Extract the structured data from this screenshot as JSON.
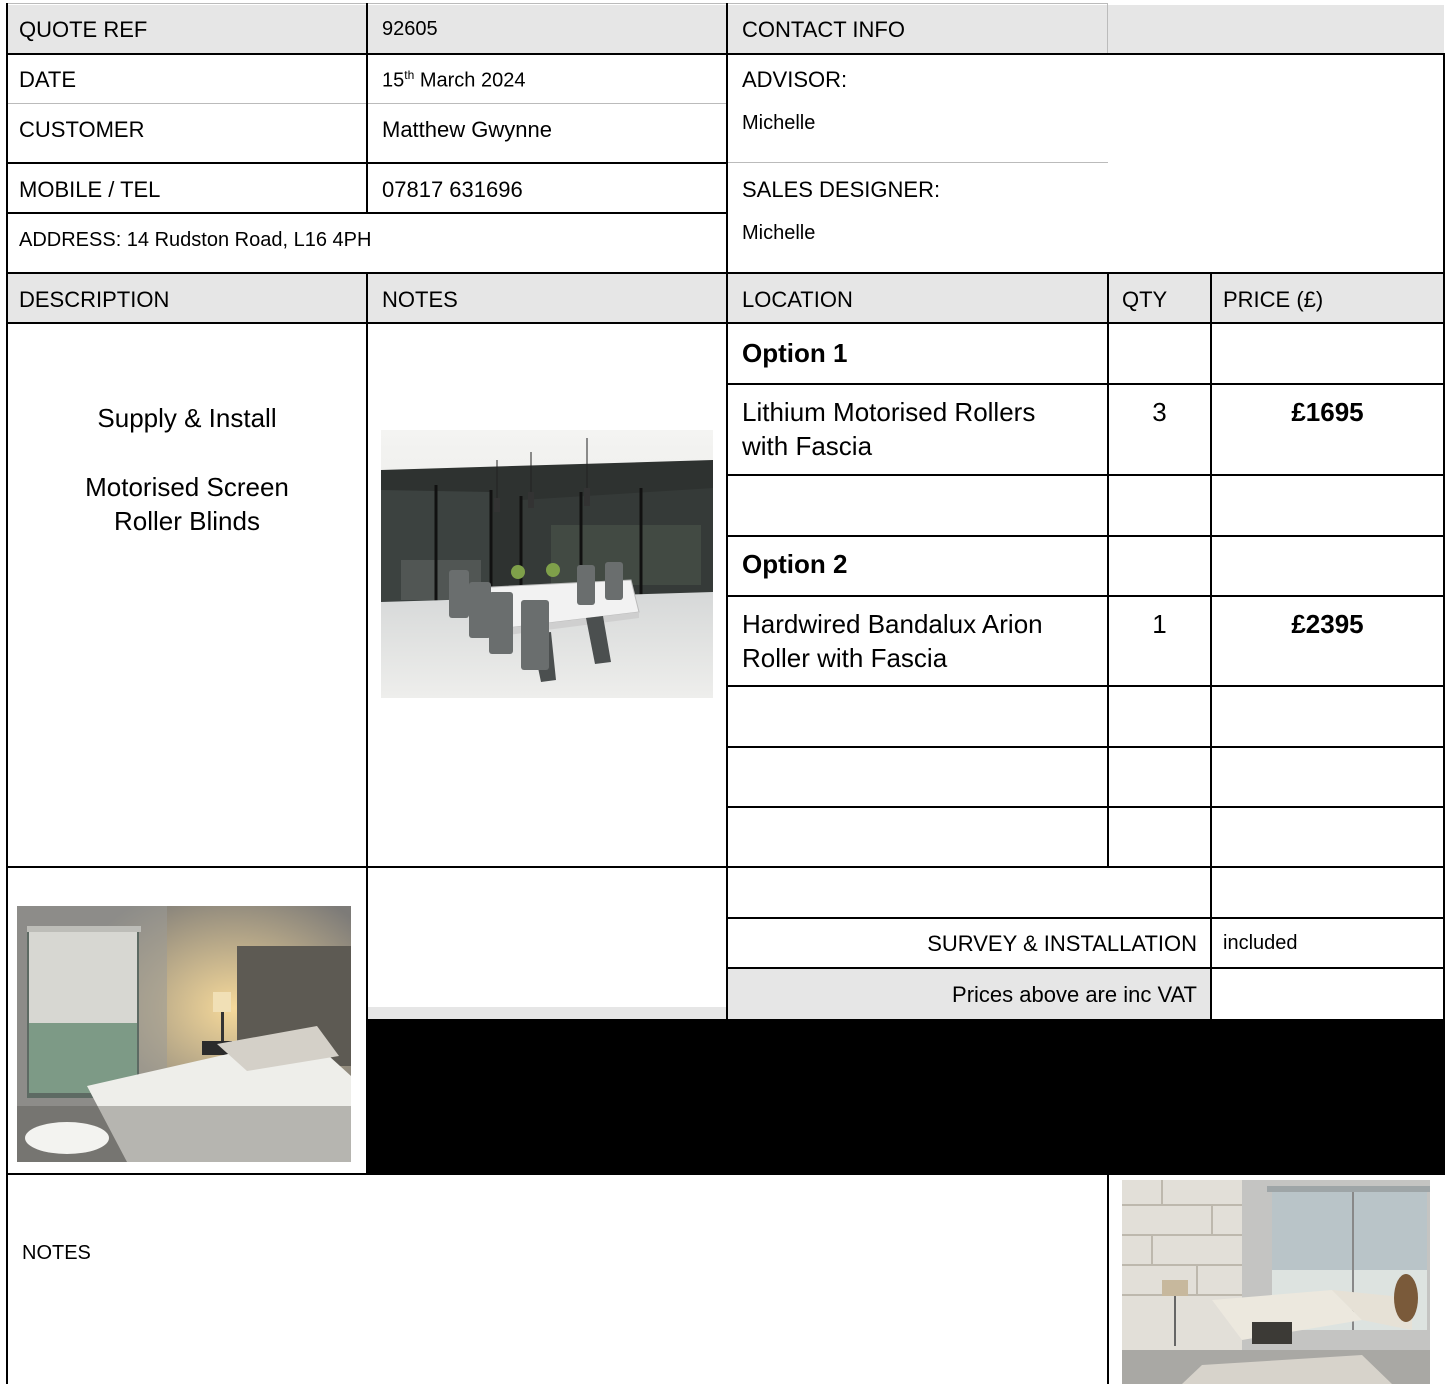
{
  "header": {
    "quote_ref_label": "QUOTE REF",
    "quote_ref_value": "92605",
    "contact_info_label": "CONTACT INFO",
    "date_label": "DATE",
    "date_day": "15",
    "date_suffix": "th",
    "date_rest": " March 2024",
    "customer_label": "CUSTOMER",
    "customer_value": "Matthew Gwynne",
    "mobile_label": "MOBILE / TEL",
    "mobile_value": "07817 631696",
    "address": "ADDRESS: 14 Rudston Road, L16 4PH",
    "advisor_label": "ADVISOR:",
    "advisor_value": "Michelle",
    "sales_designer_label": "SALES DESIGNER:",
    "sales_designer_value": "Michelle"
  },
  "columns": {
    "description": "DESCRIPTION",
    "notes": "NOTES",
    "location": "LOCATION",
    "qty": "QTY",
    "price": "PRICE (£)"
  },
  "description": {
    "line1": "Supply & Install",
    "line2": "Motorised Screen",
    "line3": "Roller Blinds"
  },
  "items": [
    {
      "location": "Option 1",
      "bold": true,
      "qty": "",
      "price": ""
    },
    {
      "location_line1": "Lithium Motorised Rollers",
      "location_line2": "with Fascia",
      "qty": "3",
      "price": "£1695"
    },
    {
      "location": "",
      "qty": "",
      "price": ""
    },
    {
      "location": "Option 2",
      "bold": true,
      "qty": "",
      "price": ""
    },
    {
      "location_line1": "Hardwired Bandalux Arion",
      "location_line2": "Roller with Fascia",
      "qty": "1",
      "price": "£2395"
    }
  ],
  "summary": {
    "survey_label": "SURVEY & INSTALLATION",
    "survey_value": "included",
    "vat_note": "Prices above are inc VAT"
  },
  "footer": {
    "notes_label": "NOTES"
  },
  "colors": {
    "header_bg": "#e6e6e6",
    "border": "#000000",
    "redaction": "#000000"
  }
}
